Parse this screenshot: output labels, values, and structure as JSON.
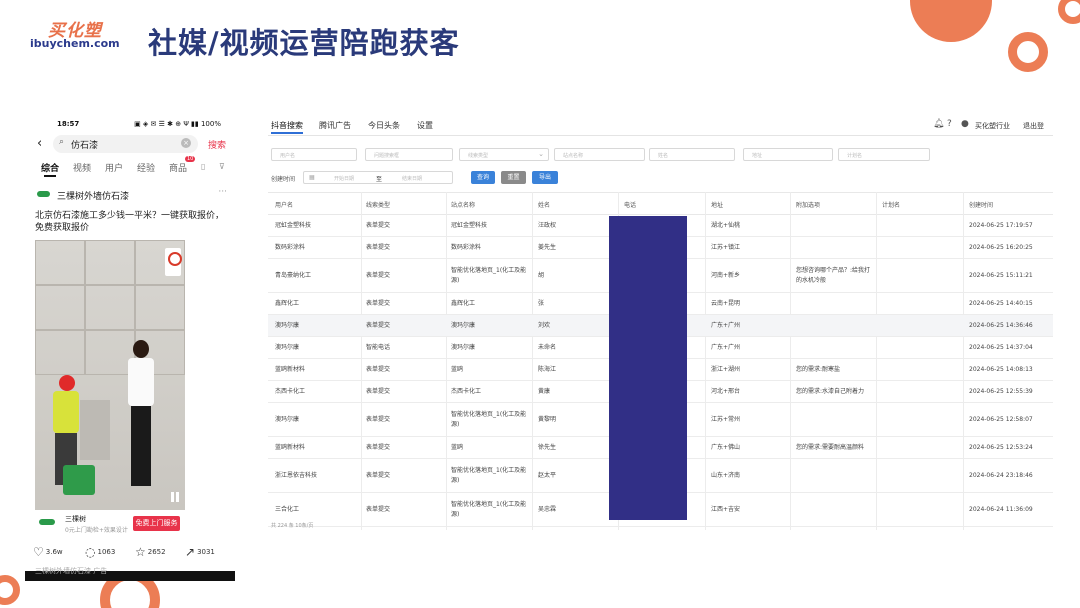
{
  "logo": {
    "cn": "买化塑",
    "en": "ibuychem.com"
  },
  "slide": {
    "title": "社媒/视频运营陪跑获客"
  },
  "phone": {
    "time": "18:57",
    "status_icons": "▣ ◈ ✉ ☰ ✱ ⊕ Ψ ▮▮ 100%",
    "query": "仿石漆",
    "search_button": "搜索",
    "tabs": [
      "综合",
      "视频",
      "用户",
      "经验",
      "商品"
    ],
    "tab_badge": "10",
    "author": "三棵树外墙仿石漆",
    "description": "北京仿石漆施工多少钱一平米？一键获取报价，免费获取报价",
    "ad": {
      "name": "三棵树",
      "sub": "0元上门勘检+效果设计",
      "button": "免费上门服务"
    },
    "actions": {
      "likes": "3.6w",
      "comments": "1063",
      "favorites": "2652",
      "shares": "3031"
    },
    "below": "三棵树外墙仿石漆 广告"
  },
  "admin": {
    "tabs": [
      "抖音搜索",
      "腾讯广告",
      "今日头条",
      "设置"
    ],
    "active_tab": "抖音搜索",
    "user": "买化塑行业",
    "logout": "退出登",
    "filters": [
      "用户名",
      "问题搜索框",
      "线索类型",
      "站点名称",
      "姓名",
      "地址",
      "计划名",
      "电话"
    ],
    "created_label": "创建时间",
    "date_start": "开始日期",
    "date_sep": "至",
    "date_end": "结束日期",
    "buttons": {
      "query": "查询",
      "reset": "重置",
      "export": "导出"
    },
    "columns": [
      "用户名",
      "线索类型",
      "站点名称",
      "姓名",
      "电话",
      "地址",
      "附加选项",
      "计划名",
      "创建时间"
    ],
    "rows": [
      {
        "user": "冠虹金塑科技",
        "type": "表单提交",
        "site": "冠虹金塑科技",
        "name": "汪政权",
        "addr": "湖北+仙桃",
        "extra": "",
        "plan": "",
        "time": "2024-06-25 17:19:57"
      },
      {
        "user": "数码彩涂料",
        "type": "表单提交",
        "site": "数码彩涂料",
        "name": "姜先生",
        "addr": "江苏+镇江",
        "extra": "",
        "plan": "",
        "time": "2024-06-25 16:20:25"
      },
      {
        "user": "青岛豪纳化工",
        "type": "表单提交",
        "site": "智能优化落地页_1(化工及能源)",
        "name": "胡",
        "addr": "河南+新乡",
        "extra": "您想咨询哪个产品？:给我打的水机冷般",
        "plan": "",
        "time": "2024-06-25 15:11:21"
      },
      {
        "user": "鑫辉化工",
        "type": "表单提交",
        "site": "鑫辉化工",
        "name": "张",
        "addr": "云南+昆明",
        "extra": "",
        "plan": "",
        "time": "2024-06-25 14:40:15"
      },
      {
        "user": "澳玛尔康",
        "type": "表单提交",
        "site": "澳玛尔康",
        "name": "刘欢",
        "addr": "广东+广州",
        "extra": "",
        "plan": "",
        "time": "2024-06-25 14:36:46"
      },
      {
        "user": "澳玛尔康",
        "type": "智能电话",
        "site": "澳玛尔康",
        "name": "未命名",
        "addr": "广东+广州",
        "extra": "",
        "plan": "",
        "time": "2024-06-25 14:37:04"
      },
      {
        "user": "蓝鸥新材料",
        "type": "表单提交",
        "site": "蓝鸥",
        "name": "陈海江",
        "addr": "浙江+湖州",
        "extra": "您的需求:耐寒盐",
        "plan": "",
        "time": "2024-06-25 14:08:13"
      },
      {
        "user": "杰西卡化工",
        "type": "表单提交",
        "site": "杰西卡化工",
        "name": "黄康",
        "addr": "河北+邢台",
        "extra": "您的需求:水漆自己附着力",
        "plan": "",
        "time": "2024-06-25 12:55:39"
      },
      {
        "user": "澳玛尔康",
        "type": "表单提交",
        "site": "智能优化落地页_1(化工及能源)",
        "name": "黄黎明",
        "addr": "江苏+常州",
        "extra": "",
        "plan": "",
        "time": "2024-06-25 12:58:07"
      },
      {
        "user": "蓝鸥新材料",
        "type": "表单提交",
        "site": "蓝鸥",
        "name": "徐先生",
        "addr": "广东+佛山",
        "extra": "您的需求:需要耐高温颜料",
        "plan": "",
        "time": "2024-06-25 12:53:24"
      },
      {
        "user": "浙江恩依吉科技",
        "type": "表单提交",
        "site": "智能优化落地页_1(化工及能源)",
        "name": "赵太平",
        "addr": "山东+济南",
        "extra": "",
        "plan": "",
        "time": "2024-06-24 23:18:46"
      },
      {
        "user": "三合化工",
        "type": "表单提交",
        "site": "智能优化落地页_1(化工及能源)",
        "name": "吴忠霖",
        "addr": "江西+吉安",
        "extra": "",
        "plan": "",
        "time": "2024-06-24 11:36:09"
      }
    ],
    "footer": "共 224 条 10条/页"
  }
}
